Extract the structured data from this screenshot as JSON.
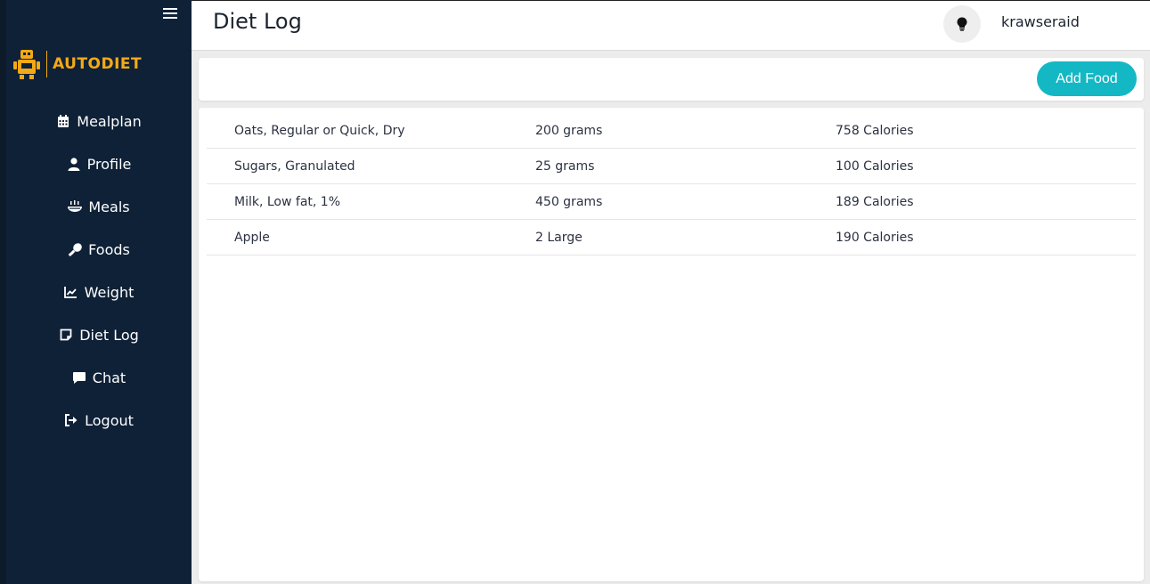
{
  "app": {
    "brand_name": "AUTODIET",
    "colors": {
      "sidebar": "#0f2137",
      "brand": "#f4a916",
      "accent": "#14b8c4"
    }
  },
  "sidebar": {
    "menu_icon": "hamburger-menu-icon",
    "items": [
      {
        "label": "Mealplan",
        "icon": "calendar-icon"
      },
      {
        "label": "Profile",
        "icon": "user-icon"
      },
      {
        "label": "Meals",
        "icon": "meal-icon"
      },
      {
        "label": "Foods",
        "icon": "drumstick-icon"
      },
      {
        "label": "Weight",
        "icon": "line-chart-icon"
      },
      {
        "label": "Diet Log",
        "icon": "note-icon"
      },
      {
        "label": "Chat",
        "icon": "chat-bubble-icon"
      },
      {
        "label": "Logout",
        "icon": "logout-icon"
      }
    ]
  },
  "header": {
    "title": "Diet Log",
    "theme_icon": "lightbulb-icon",
    "username": "krawseraid"
  },
  "actions": {
    "add_food_label": "Add Food"
  },
  "diet_log": {
    "rows": [
      {
        "food": "Oats, Regular or Quick, Dry",
        "amount": "200 grams",
        "calories": "758 Calories"
      },
      {
        "food": "Sugars, Granulated",
        "amount": "25 grams",
        "calories": "100 Calories"
      },
      {
        "food": "Milk, Low fat, 1%",
        "amount": "450 grams",
        "calories": "189 Calories"
      },
      {
        "food": "Apple",
        "amount": "2 Large",
        "calories": "190 Calories"
      }
    ]
  }
}
